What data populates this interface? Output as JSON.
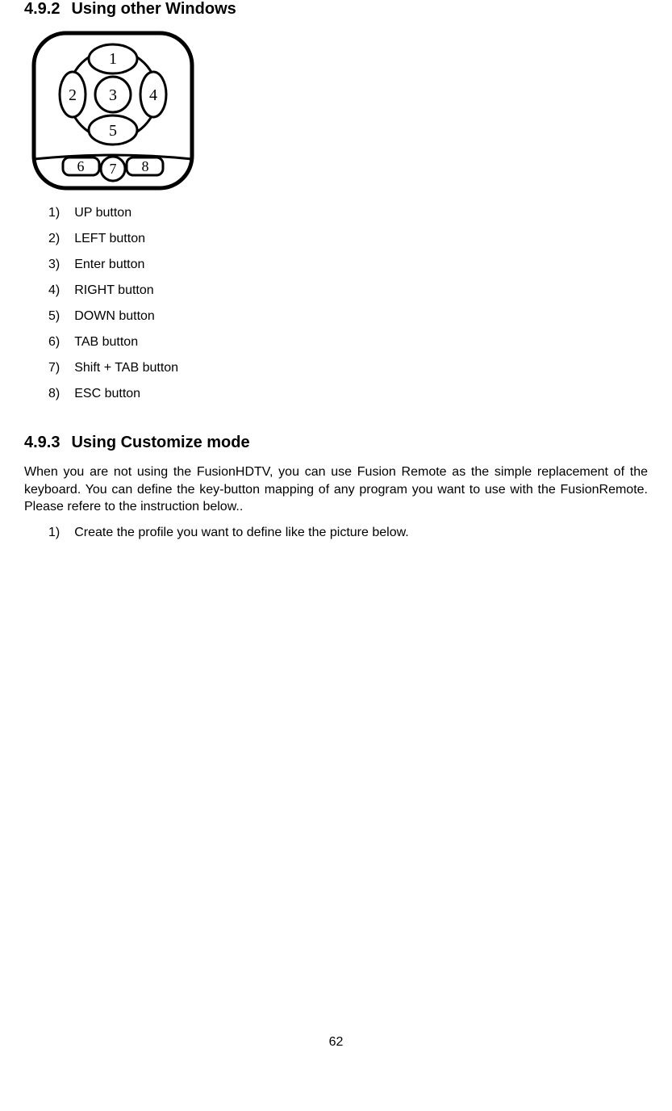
{
  "section1": {
    "number": "4.9.2",
    "title": "Using other Windows"
  },
  "remote": {
    "labels": [
      "1",
      "2",
      "3",
      "4",
      "5",
      "6",
      "7",
      "8"
    ]
  },
  "button_list": [
    {
      "num": "1)",
      "label": "UP button"
    },
    {
      "num": "2)",
      "label": "LEFT button"
    },
    {
      "num": "3)",
      "label": "Enter button"
    },
    {
      "num": "4)",
      "label": "RIGHT button"
    },
    {
      "num": "5)",
      "label": "DOWN button"
    },
    {
      "num": "6)",
      "label": "TAB button"
    },
    {
      "num": "7)",
      "label": "Shift + TAB button"
    },
    {
      "num": "8)",
      "label": "ESC button"
    }
  ],
  "section2": {
    "number": "4.9.3",
    "title": "Using Customize mode"
  },
  "paragraph": "When you are not using the FusionHDTV, you can use Fusion Remote as the simple replacement of the keyboard. You can define the key-button mapping of any program you want to use with the FusionRemote. Please refere to the instruction below..",
  "steps": [
    {
      "num": "1)",
      "label": "Create the profile you want to define like the picture below."
    }
  ],
  "page_number": "62"
}
